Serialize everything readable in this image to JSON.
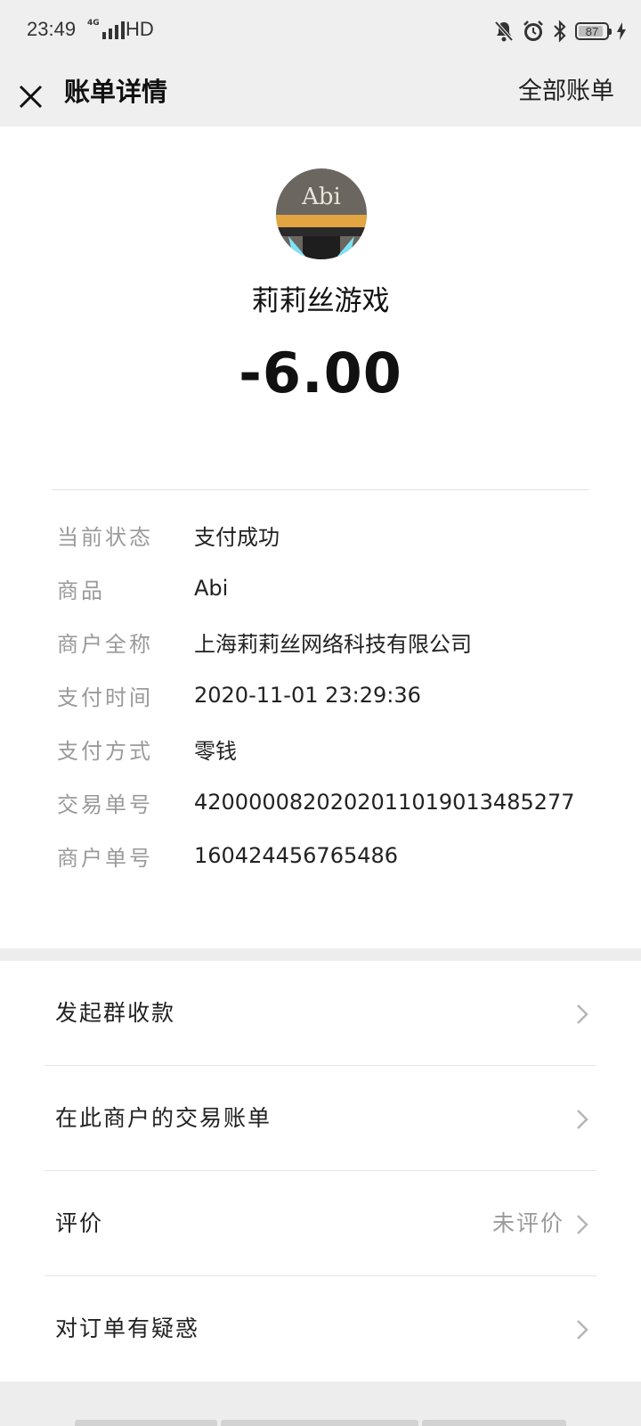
{
  "status_bar": {
    "time": "23:49",
    "network": "4G",
    "hd": "HD",
    "battery": "87"
  },
  "nav": {
    "title": "账单详情",
    "right_link": "全部账单"
  },
  "bill": {
    "avatar_text": "Abi",
    "merchant": "莉莉丝游戏",
    "amount": "-6.00",
    "details": [
      {
        "label": "当前状态",
        "value": "支付成功"
      },
      {
        "label": "商品",
        "value": "Abi"
      },
      {
        "label": "商户全称",
        "value": "上海莉莉丝网络科技有限公司"
      },
      {
        "label": "支付时间",
        "value": "2020-11-01 23:29:36"
      },
      {
        "label": "支付方式",
        "value": "零钱"
      },
      {
        "label": "交易单号",
        "value": "4200000820202011019013485277"
      },
      {
        "label": "商户单号",
        "value": "1604244567654​86"
      }
    ]
  },
  "actions": [
    {
      "label": "发起群收款",
      "value": ""
    },
    {
      "label": "在此商户的交易账单",
      "value": ""
    },
    {
      "label": "评价",
      "value": "未评价"
    },
    {
      "label": "对订单有疑惑",
      "value": ""
    }
  ],
  "colors": {
    "background": "#ededed",
    "card": "#ffffff",
    "secondary_text": "#9a9a9a"
  }
}
